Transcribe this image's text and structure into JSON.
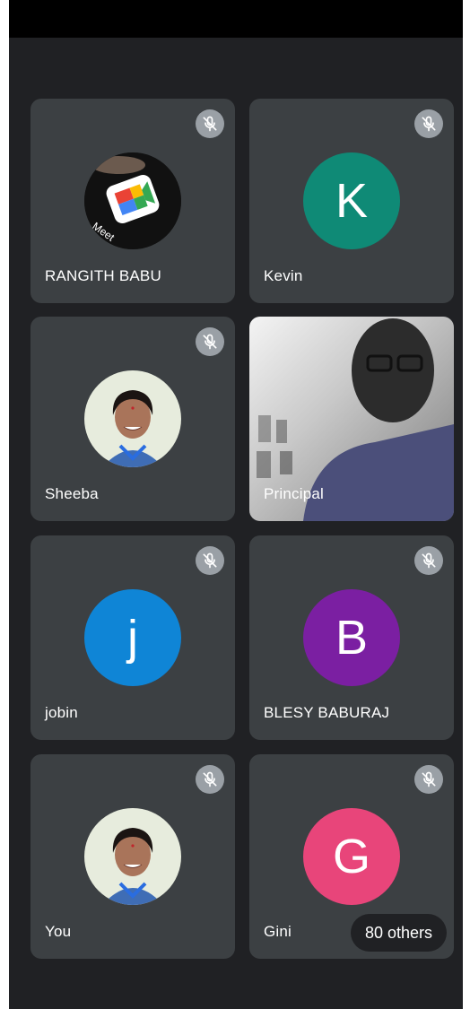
{
  "participants": [
    {
      "name": "RANGITH BABU",
      "avatar_type": "meet-logo",
      "muted": true
    },
    {
      "name": "Kevin",
      "avatar_letter": "K",
      "avatar_color": "#0f8a76",
      "muted": true
    },
    {
      "name": "Sheeba",
      "avatar_type": "photo",
      "muted": true
    },
    {
      "name": "Principal",
      "avatar_type": "video",
      "muted": false
    },
    {
      "name": "jobin",
      "avatar_letter": "j",
      "avatar_color": "#0f85d6",
      "muted": true
    },
    {
      "name": "BLESY BABURAJ",
      "avatar_letter": "B",
      "avatar_color": "#7b1fa2",
      "muted": true
    },
    {
      "name": "You",
      "avatar_type": "photo",
      "muted": true
    },
    {
      "name": "Gini",
      "avatar_letter": "G",
      "avatar_color": "#e8457a",
      "muted": true
    }
  ],
  "others_label": "80 others",
  "logo_text": "Meet",
  "colors": {
    "background": "#202124",
    "tile": "#3c4043",
    "mute_badge": "#9aa0a6"
  }
}
